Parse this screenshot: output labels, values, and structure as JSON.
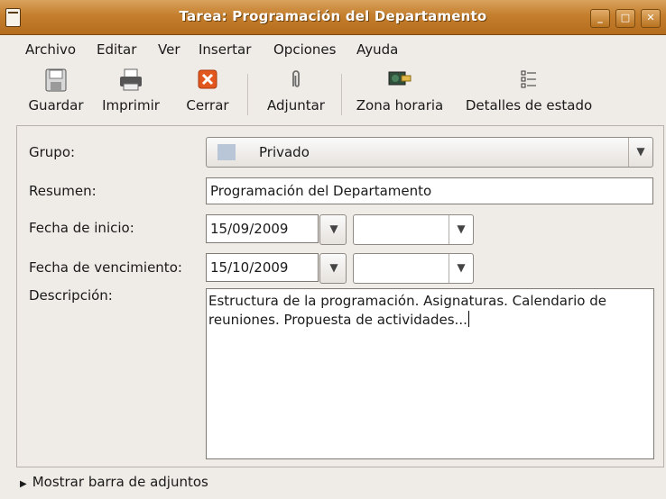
{
  "window": {
    "title": "Tarea: Programación del Departamento"
  },
  "menu": {
    "archivo": "Archivo",
    "editar": "Editar",
    "ver": "Ver",
    "insertar": "Insertar",
    "opciones": "Opciones",
    "ayuda": "Ayuda"
  },
  "toolbar": {
    "guardar": "Guardar",
    "imprimir": "Imprimir",
    "cerrar": "Cerrar",
    "adjuntar": "Adjuntar",
    "zona_horaria": "Zona horaria",
    "detalles_estado": "Detalles de estado"
  },
  "form": {
    "grupo_label": "Grupo:",
    "grupo_value": "Privado",
    "grupo_color": "#b8c6d8",
    "resumen_label": "Resumen:",
    "resumen_value": "Programación del Departamento",
    "inicio_label": "Fecha de inicio:",
    "inicio_date": "15/09/2009",
    "inicio_time": "",
    "vencimiento_label": "Fecha de vencimiento:",
    "vencimiento_date": "15/10/2009",
    "vencimiento_time": "",
    "descripcion_label": "Descripción:",
    "descripcion_value": "Estructura de la programación. Asignaturas. Calendario de reuniones. Propuesta de actividades..."
  },
  "attachments": {
    "toggle_label": "Mostrar barra de adjuntos"
  }
}
